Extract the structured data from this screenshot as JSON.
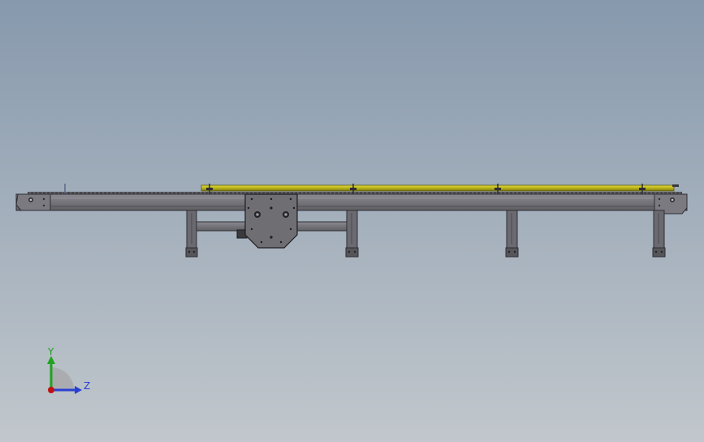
{
  "viewport": {
    "background_top": "#8799AD",
    "background_bottom": "#C1C7CC"
  },
  "model": {
    "frame_color": "#6E6E73",
    "frame_dark": "#3A3A3E",
    "rail_color": "#C8C21E",
    "rail_dark": "#7A7410"
  },
  "triad": {
    "y_label": "Y",
    "z_label": "Z",
    "y_color": "#1FA21F",
    "z_color": "#2A3FD0",
    "x_color": "#C01010"
  }
}
